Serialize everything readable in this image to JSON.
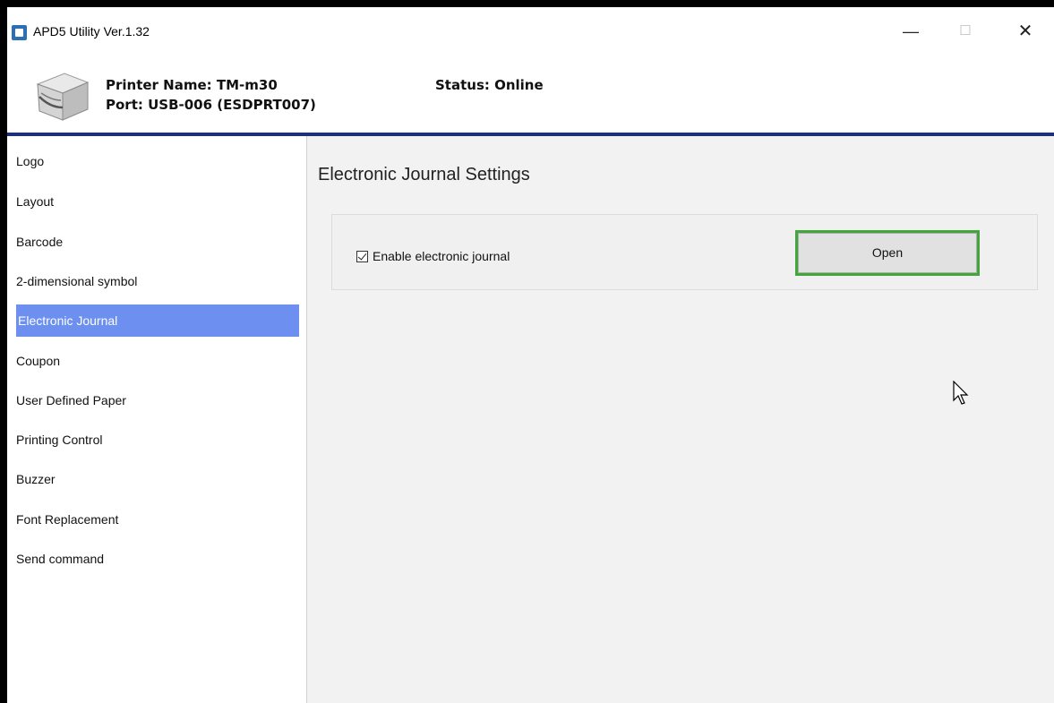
{
  "window": {
    "title": "APD5 Utility Ver.1.32",
    "minimize": "—",
    "maximize": "☐",
    "close": "✕"
  },
  "header": {
    "printer_name": "Printer Name: TM-m30",
    "port": "Port: USB-006 (ESDPRT007)",
    "status": "Status: Online"
  },
  "sidebar": {
    "items": [
      {
        "label": "Logo"
      },
      {
        "label": "Layout"
      },
      {
        "label": "Barcode"
      },
      {
        "label": "2-dimensional symbol"
      },
      {
        "label": "Electronic Journal",
        "active": true
      },
      {
        "label": "Coupon"
      },
      {
        "label": "User Defined Paper"
      },
      {
        "label": "Printing Control"
      },
      {
        "label": "Buzzer"
      },
      {
        "label": "Font Replacement"
      },
      {
        "label": "Send command"
      }
    ]
  },
  "main": {
    "title": "Electronic Journal Settings",
    "enable_checkbox": {
      "label": "Enable electronic journal",
      "checked": true
    },
    "open_button": "Open"
  },
  "colors": {
    "header_rule": "#1e2f7b",
    "active_item": "#6c8ff0",
    "highlight": "#43a63b"
  }
}
